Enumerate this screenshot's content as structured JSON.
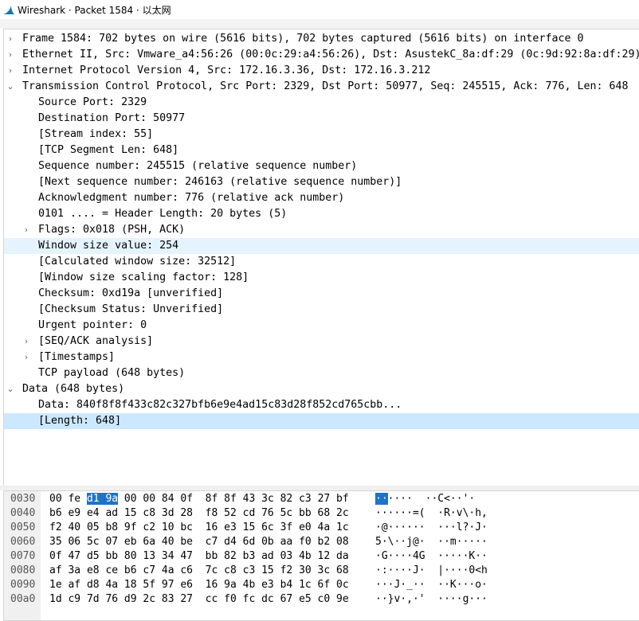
{
  "window": {
    "title": "Wireshark · Packet 1584 · 以太网"
  },
  "tree": [
    {
      "text": "Frame 1584: 702 bytes on wire (5616 bits), 702 bytes captured (5616 bits) on interface 0",
      "expander": "›",
      "indent": 0
    },
    {
      "text": "Ethernet II, Src: Vmware_a4:56:26 (00:0c:29:a4:56:26), Dst: AsustekC_8a:df:29 (0c:9d:92:8a:df:29)",
      "expander": "›",
      "indent": 0
    },
    {
      "text": "Internet Protocol Version 4, Src: 172.16.3.36, Dst: 172.16.3.212",
      "expander": "›",
      "indent": 0
    },
    {
      "text": "Transmission Control Protocol, Src Port: 2329, Dst Port: 50977, Seq: 245515, Ack: 776, Len: 648",
      "expander": "⌄",
      "indent": 0
    },
    {
      "text": "Source Port: 2329",
      "expander": "",
      "indent": 1
    },
    {
      "text": "Destination Port: 50977",
      "expander": "",
      "indent": 1
    },
    {
      "text": "[Stream index: 55]",
      "expander": "",
      "indent": 1
    },
    {
      "text": "[TCP Segment Len: 648]",
      "expander": "",
      "indent": 1
    },
    {
      "text": "Sequence number: 245515    (relative sequence number)",
      "expander": "",
      "indent": 1
    },
    {
      "text": "[Next sequence number: 246163    (relative sequence number)]",
      "expander": "",
      "indent": 1
    },
    {
      "text": "Acknowledgment number: 776    (relative ack number)",
      "expander": "",
      "indent": 1
    },
    {
      "text": "0101 .... = Header Length: 20 bytes (5)",
      "expander": "",
      "indent": 1
    },
    {
      "text": "Flags: 0x018 (PSH, ACK)",
      "expander": "›",
      "indent": 1
    },
    {
      "text": "Window size value: 254",
      "expander": "",
      "indent": 1,
      "state": "hover"
    },
    {
      "text": "[Calculated window size: 32512]",
      "expander": "",
      "indent": 1
    },
    {
      "text": "[Window size scaling factor: 128]",
      "expander": "",
      "indent": 1
    },
    {
      "text": "Checksum: 0xd19a [unverified]",
      "expander": "",
      "indent": 1
    },
    {
      "text": "[Checksum Status: Unverified]",
      "expander": "",
      "indent": 1
    },
    {
      "text": "Urgent pointer: 0",
      "expander": "",
      "indent": 1
    },
    {
      "text": "[SEQ/ACK analysis]",
      "expander": "›",
      "indent": 1
    },
    {
      "text": "[Timestamps]",
      "expander": "›",
      "indent": 1
    },
    {
      "text": "TCP payload (648 bytes)",
      "expander": "",
      "indent": 1
    },
    {
      "text": "Data (648 bytes)",
      "expander": "⌄",
      "indent": 0
    },
    {
      "text": "Data: 840f8f8f433c82c327bfb6e9e4ad15c83d28f852cd765cbb...",
      "expander": "",
      "indent": 1
    },
    {
      "text": "[Length: 648]",
      "expander": "",
      "indent": 1,
      "state": "selected"
    }
  ],
  "hexdump": [
    {
      "offset": "0030",
      "hex_pre": "00 fe ",
      "hex_hl": "d1 9a",
      "hex_post": " 00 00 84 0f  8f 8f 43 3c 82 c3 27 bf",
      "ascii_pre": "",
      "ascii_hl": "··",
      "ascii_post": "····  ··C<··'·"
    },
    {
      "offset": "0040",
      "hex_pre": "b6 e9 e4 ad 15 c8 3d 28  f8 52 cd 76 5c bb 68 2c",
      "hex_hl": "",
      "hex_post": "",
      "ascii_pre": "······=(  ·R·v\\·h,",
      "ascii_hl": "",
      "ascii_post": ""
    },
    {
      "offset": "0050",
      "hex_pre": "f2 40 05 b8 9f c2 10 bc  16 e3 15 6c 3f e0 4a 1c",
      "hex_hl": "",
      "hex_post": "",
      "ascii_pre": "·@······  ···l?·J·",
      "ascii_hl": "",
      "ascii_post": ""
    },
    {
      "offset": "0060",
      "hex_pre": "35 06 5c 07 eb 6a 40 be  c7 d4 6d 0b aa f0 b2 08",
      "hex_hl": "",
      "hex_post": "",
      "ascii_pre": "5·\\··j@·  ··m·····",
      "ascii_hl": "",
      "ascii_post": ""
    },
    {
      "offset": "0070",
      "hex_pre": "0f 47 d5 bb 80 13 34 47  bb 82 b3 ad 03 4b 12 da",
      "hex_hl": "",
      "hex_post": "",
      "ascii_pre": "·G····4G  ·····K··",
      "ascii_hl": "",
      "ascii_post": ""
    },
    {
      "offset": "0080",
      "hex_pre": "af 3a e8 ce b6 c7 4a c6  7c c8 c3 15 f2 30 3c 68",
      "hex_hl": "",
      "hex_post": "",
      "ascii_pre": "·:····J·  |····0<h",
      "ascii_hl": "",
      "ascii_post": ""
    },
    {
      "offset": "0090",
      "hex_pre": "1e af d8 4a 18 5f 97 e6  16 9a 4b e3 b4 1c 6f 0c",
      "hex_hl": "",
      "hex_post": "",
      "ascii_pre": "···J·_··  ··K···o·",
      "ascii_hl": "",
      "ascii_post": ""
    },
    {
      "offset": "00a0",
      "hex_pre": "1d c9 7d 76 d9 2c 83 27  cc f0 fc dc 67 e5 c0 9e",
      "hex_hl": "",
      "hex_post": "",
      "ascii_pre": "··}v·,·'  ····g···",
      "ascii_hl": "",
      "ascii_post": ""
    }
  ],
  "colors": {
    "hover_row": "#e5f3ff",
    "selected_row": "#cce8ff",
    "byte_highlight": "#1e73c8",
    "logo": "#1679a7"
  },
  "icons": {
    "app": "wireshark-fin-icon",
    "collapsed": "chevron-right-icon",
    "expanded": "chevron-down-icon"
  }
}
